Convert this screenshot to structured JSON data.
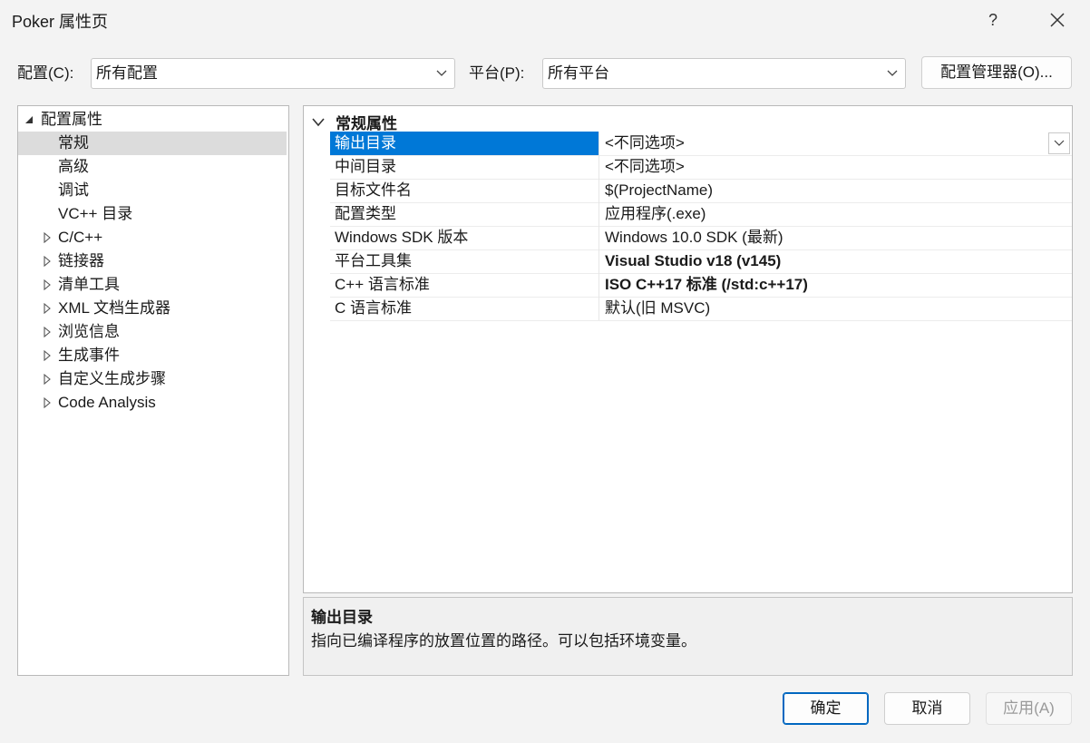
{
  "window": {
    "title": "Poker 属性页",
    "help_label": "?"
  },
  "toolbar": {
    "config_label": "配置(C):",
    "config_value": "所有配置",
    "platform_label": "平台(P):",
    "platform_value": "所有平台",
    "config_manager_label": "配置管理器(O)..."
  },
  "tree": {
    "items": [
      {
        "label": "配置属性",
        "expanded": true
      },
      {
        "label": "常规",
        "selected": true
      },
      {
        "label": "高级"
      },
      {
        "label": "调试"
      },
      {
        "label": "VC++ 目录"
      },
      {
        "label": "C/C++"
      },
      {
        "label": "链接器"
      },
      {
        "label": "清单工具"
      },
      {
        "label": "XML 文档生成器"
      },
      {
        "label": "浏览信息"
      },
      {
        "label": "生成事件"
      },
      {
        "label": "自定义生成步骤"
      },
      {
        "label": "Code Analysis"
      }
    ]
  },
  "grid": {
    "category": "常规属性",
    "rows": [
      {
        "name": "输出目录",
        "value": "<不同选项>"
      },
      {
        "name": "中间目录",
        "value": "<不同选项>"
      },
      {
        "name": "目标文件名",
        "value": "$(ProjectName)"
      },
      {
        "name": "配置类型",
        "value": "应用程序(.exe)"
      },
      {
        "name": "Windows SDK 版本",
        "value": "Windows 10.0 SDK (最新)"
      },
      {
        "name": "平台工具集",
        "value": "Visual Studio v18 (v145)"
      },
      {
        "name": "C++ 语言标准",
        "value": "ISO C++17 标准 (/std:c++17)"
      },
      {
        "name": "C 语言标准",
        "value": "默认(旧 MSVC)"
      }
    ]
  },
  "description": {
    "title": "输出目录",
    "text": "指向已编译程序的放置位置的路径。可以包括环境变量。"
  },
  "footer": {
    "ok_label": "确定",
    "cancel_label": "取消",
    "apply_label": "应用(A)"
  },
  "colors": {
    "selection": "#0078d7",
    "primary_border": "#0067c0"
  }
}
